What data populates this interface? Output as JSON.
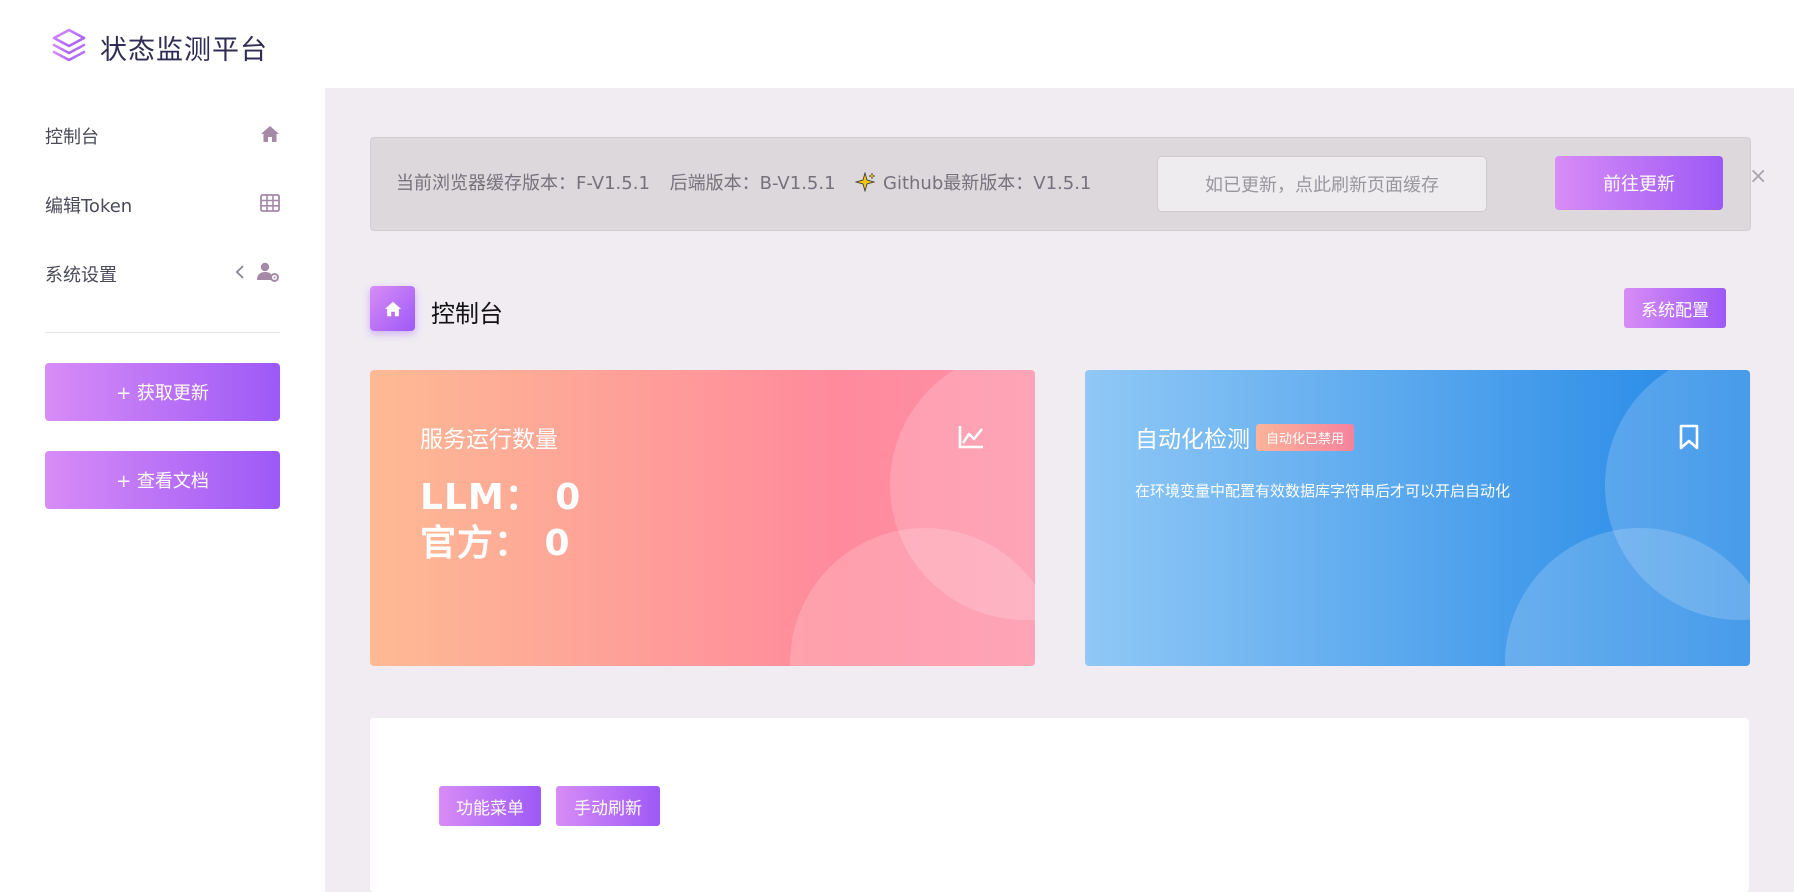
{
  "app": {
    "title": "状态监测平台",
    "accent": "#9d59f6"
  },
  "sidebar": {
    "items": [
      {
        "label": "控制台",
        "icon": "home-icon"
      },
      {
        "label": "编辑Token",
        "icon": "table-icon"
      },
      {
        "label": "系统设置",
        "icon": "user-settings-icon"
      }
    ],
    "buttons": [
      {
        "label": "+ 获取更新"
      },
      {
        "label": "+ 查看文档"
      }
    ]
  },
  "notice": {
    "browser_version": "当前浏览器缓存版本：F-V1.5.1",
    "backend_version": "后端版本：B-V1.5.1",
    "github_version": "Github最新版本：V1.5.1",
    "refresh_placeholder": "如已更新，点此刷新页面缓存",
    "update_label": "前往更新",
    "close_label": "×"
  },
  "page": {
    "title": "控制台",
    "config_label": "系统配置"
  },
  "cards": {
    "services": {
      "title": "服务运行数量",
      "llm": "LLM：  0",
      "official": "官方：  0",
      "icon": "line-chart-icon",
      "colors": [
        "#feba94",
        "#ff8a9c"
      ]
    },
    "automation": {
      "title": "自动化检测",
      "badge": "自动化已禁用",
      "desc": "在环境变量中配置有效数据库字符串后才可以开启自动化",
      "icon": "bookmark-icon",
      "colors": [
        "#90c8f6",
        "#1f86e6"
      ]
    }
  },
  "panel": {
    "buttons": [
      {
        "label": "功能菜单"
      },
      {
        "label": "手动刷新"
      }
    ]
  }
}
